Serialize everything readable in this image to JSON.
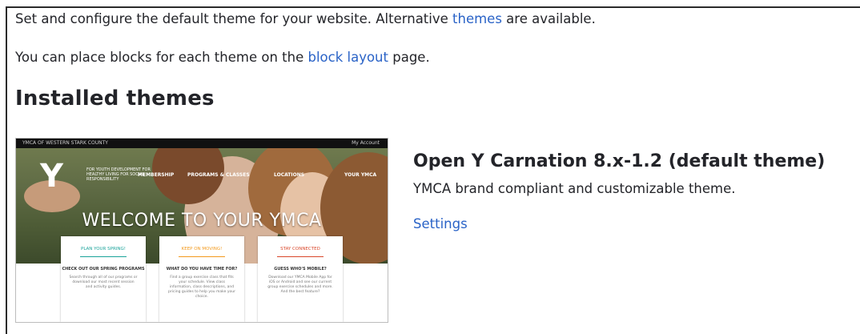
{
  "intro": {
    "line1_before": "Set and configure the default theme for your website. Alternative ",
    "line1_link": "themes",
    "line1_after": " are available.",
    "line2_before": "You can place blocks for each theme on the ",
    "line2_link": "block layout",
    "line2_after": " page."
  },
  "section_title": "Installed themes",
  "theme": {
    "name": "Open Y Carnation 8.x-1.2 (default theme)",
    "description": "YMCA brand compliant and customizable theme.",
    "settings_link": "Settings",
    "screenshot": {
      "topbar_left": "YMCA OF WESTERN STARK COUNTY",
      "topbar_right": "My Account",
      "logo_text": "FOR YOUTH DEVELOPMENT FOR HEALTHY LIVING FOR SOCIAL RESPONSIBILITY",
      "nav": [
        "MEMBERSHIP",
        "PROGRAMS & CLASSES",
        "LOCATIONS",
        "YOUR YMCA"
      ],
      "headline": "WELCOME TO YOUR YMCA",
      "cards": [
        {
          "title": "PLAN YOUR SPRING!",
          "color": "#1aa39a",
          "subtitle": "CHECK OUT OUR SPRING PROGRAMS",
          "body": "Search through all of our programs or download our most recent session and activity guides."
        },
        {
          "title": "KEEP ON MOVING!",
          "color": "#f39a1e",
          "subtitle": "WHAT DO YOU HAVE TIME FOR?",
          "body": "Find a group exercise class that fits your schedule. View class information, class descriptions, and pricing guides to help you make your choice."
        },
        {
          "title": "STAY CONNECTED",
          "color": "#d9482b",
          "subtitle": "GUESS WHO'S MOBILE?",
          "body": "Download our YMCA Mobile App for iOS or Android and see our current group exercise schedules and more. And the best feature?"
        }
      ]
    }
  }
}
